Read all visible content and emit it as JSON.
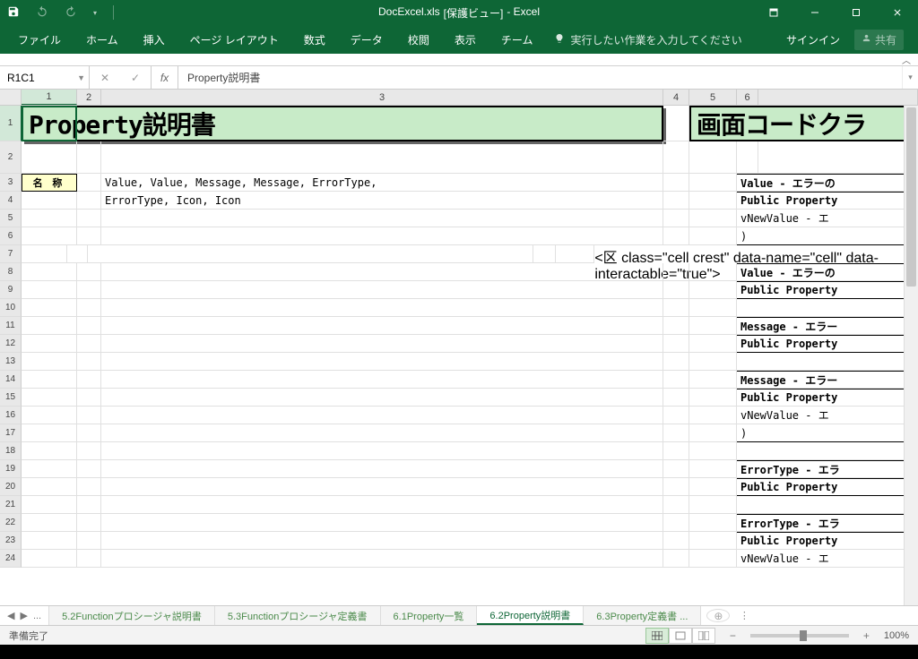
{
  "titlebar": {
    "doc_name": "DocExcel.xls",
    "view_mode": "[保護ビュー]",
    "app_name": "- Excel"
  },
  "ribbon": {
    "tabs": [
      "ファイル",
      "ホーム",
      "挿入",
      "ページ レイアウト",
      "数式",
      "データ",
      "校閲",
      "表示",
      "チーム"
    ],
    "tellme_placeholder": "実行したい作業を入力してください",
    "signin": "サインイン",
    "share": "共有"
  },
  "namebox": "R1C1",
  "formula": "Property説明書",
  "columns": [
    "1",
    "2",
    "3",
    "4",
    "5",
    "6"
  ],
  "rows": [
    "1",
    "2",
    "3",
    "4",
    "5",
    "6",
    "7",
    "8",
    "9",
    "10",
    "11",
    "12",
    "13",
    "14",
    "15",
    "16",
    "17",
    "18",
    "19",
    "20",
    "21",
    "22",
    "23",
    "24"
  ],
  "sheet": {
    "title1": "Property説明書",
    "title2": "画面コードクラ",
    "r3c1": "名 称",
    "r3c3": "Value, Value, Message, Message, ErrorType,",
    "r4c3": "ErrorType, Icon, Icon",
    "right_rows": {
      "3": "Value - エラーの",
      "4": "Public Property",
      "5": "  vNewValue  - エ",
      "6": ")",
      "8": "Value - エラーの",
      "9": "Public Property",
      "11": "Message - エラー",
      "12": "Public Property",
      "14": "Message - エラー",
      "15": "Public Property",
      "16": "  vNewValue  - エ",
      "17": ")",
      "19": "ErrorType - エラ",
      "20": "Public Property",
      "22": "ErrorType - エラ",
      "23": "Public Property",
      "24": "  vNewValue  - エ"
    }
  },
  "tabs": {
    "nav_more": "...",
    "items": [
      "5.2Functionプロシージャ説明書",
      "5.3Functionプロシージャ定義書",
      "6.1Property一覧",
      "6.2Property説明書",
      "6.3Property定義書 ..."
    ],
    "active_index": 3
  },
  "status": {
    "ready": "準備完了",
    "zoom": "100%"
  }
}
